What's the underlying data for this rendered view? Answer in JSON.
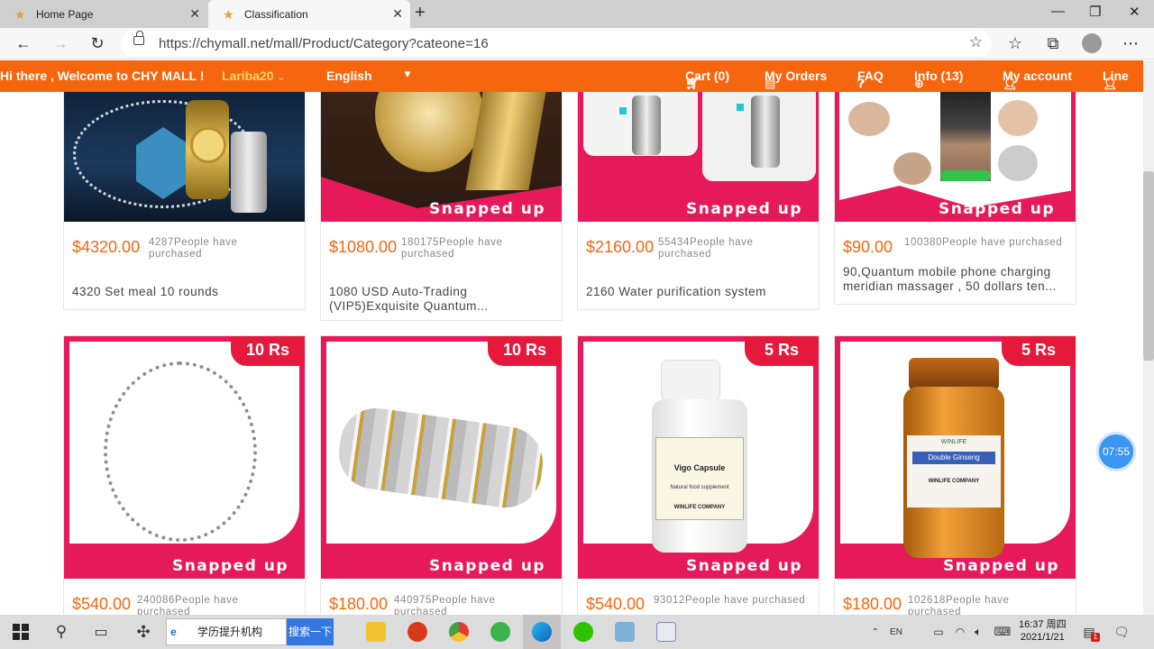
{
  "browser": {
    "tabs": [
      {
        "label": "Home Page"
      },
      {
        "label": "Classification"
      }
    ],
    "url": "https://chymall.net/mall/Product/Category?cateone=16"
  },
  "site": {
    "welcome": "Hi there , Welcome to CHY MALL !",
    "username": "Lariba20",
    "language": "English",
    "nav": {
      "cart": "Cart (0)",
      "orders": "My Orders",
      "faq": "FAQ",
      "info": "Info (13)",
      "account": "My account",
      "line": "Line"
    }
  },
  "products": [
    {
      "price": "$4320.00",
      "buyers": "4287People have purchased",
      "name": "4320 Set meal 10 rounds",
      "badge": "Snapped up"
    },
    {
      "price": "$1080.00",
      "buyers": "180175People have purchased",
      "name": "1080 USD Auto-Trading (VIP5)Exquisite Quantum...",
      "badge": "Snapped up"
    },
    {
      "price": "$2160.00",
      "buyers": "55434People have purchased",
      "name": "2160 Water purification system",
      "badge": "Snapped up"
    },
    {
      "price": "$90.00",
      "buyers": "100380People have purchased",
      "name": "90,Quantum mobile phone charging meridian massager , 50 dollars ten...",
      "badge": "Snapped up"
    },
    {
      "price": "$540.00",
      "buyers": "240086People have purchased",
      "ribbon": "10 Rs",
      "badge": "Snapped up"
    },
    {
      "price": "$180.00",
      "buyers": "440975People have purchased",
      "ribbon": "10 Rs",
      "badge": "Snapped up"
    },
    {
      "price": "$540.00",
      "buyers": "93012People have purchased",
      "ribbon": "5 Rs",
      "badge": "Snapped up",
      "label_main": "Vigo Capsule",
      "label_sub": "Natural food supplement",
      "label_company": "WINLIFE COMPANY"
    },
    {
      "price": "$180.00",
      "buyers": "102618People have purchased",
      "ribbon": "5 Rs",
      "badge": "Snapped up",
      "label_brand": "WINLIFE",
      "label_main": "Double Ginseng",
      "label_company": "WINLIFE COMPANY"
    }
  ],
  "timer": "07:55",
  "taskbar": {
    "search_text": "学历提升机构",
    "search_button": "搜索一下",
    "ime": "EN",
    "time": "16:37 周四",
    "date": "2021/1/21",
    "notification_count": "1"
  },
  "colors": {
    "accent": "#f5660e",
    "ribbon": "#e6193c",
    "card_frame": "#e6195a"
  }
}
